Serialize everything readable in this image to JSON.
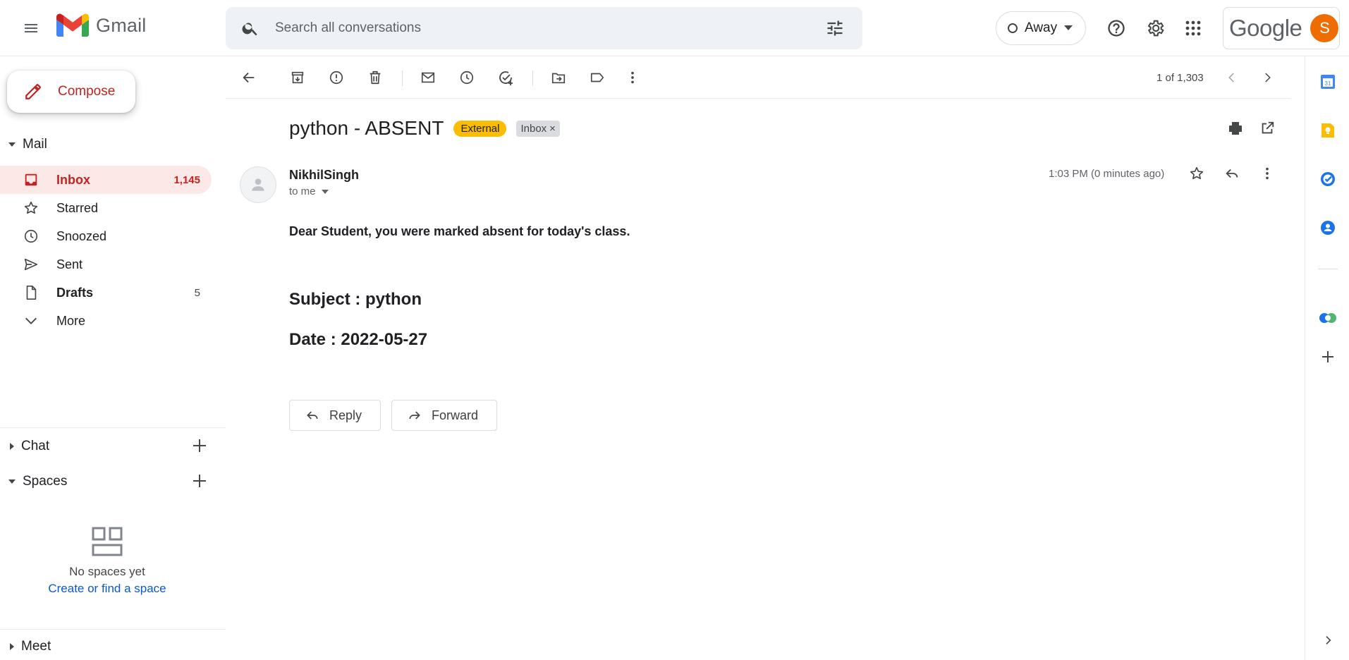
{
  "header": {
    "app_name": "Gmail",
    "search_placeholder": "Search all conversations",
    "status_label": "Away",
    "account_brand": "Google",
    "account_initial": "S"
  },
  "sidebar": {
    "compose_label": "Compose",
    "mail_section": "Mail",
    "items": [
      {
        "label": "Inbox",
        "count": "1,145",
        "icon": "inbox-icon"
      },
      {
        "label": "Starred",
        "count": "",
        "icon": "star-icon"
      },
      {
        "label": "Snoozed",
        "count": "",
        "icon": "clock-icon"
      },
      {
        "label": "Sent",
        "count": "",
        "icon": "send-icon"
      },
      {
        "label": "Drafts",
        "count": "5",
        "icon": "draft-icon"
      },
      {
        "label": "More",
        "count": "",
        "icon": "chevron-down-icon"
      }
    ],
    "chat_section": "Chat",
    "spaces_section": "Spaces",
    "no_spaces_text": "No spaces yet",
    "create_space_link": "Create or find a space",
    "meet_section": "Meet"
  },
  "toolbar": {
    "pager": "1 of 1,303"
  },
  "message": {
    "subject": "python - ABSENT",
    "labels": [
      "External",
      "Inbox"
    ],
    "sender": "NikhilSingh",
    "recipient": "to me",
    "time": "1:03 PM (0 minutes ago)",
    "body_intro": "Dear Student, you were marked absent for today's class.",
    "body_subject": "Subject : python",
    "body_date": "Date : 2022-05-27"
  },
  "actions": {
    "reply": "Reply",
    "forward": "Forward"
  },
  "colors": {
    "accent_red": "#c5221f",
    "active_bg": "#fce8e6",
    "external_badge": "#fbbc04",
    "link_blue": "#0b57d0",
    "avatar_orange": "#ef6c00"
  }
}
